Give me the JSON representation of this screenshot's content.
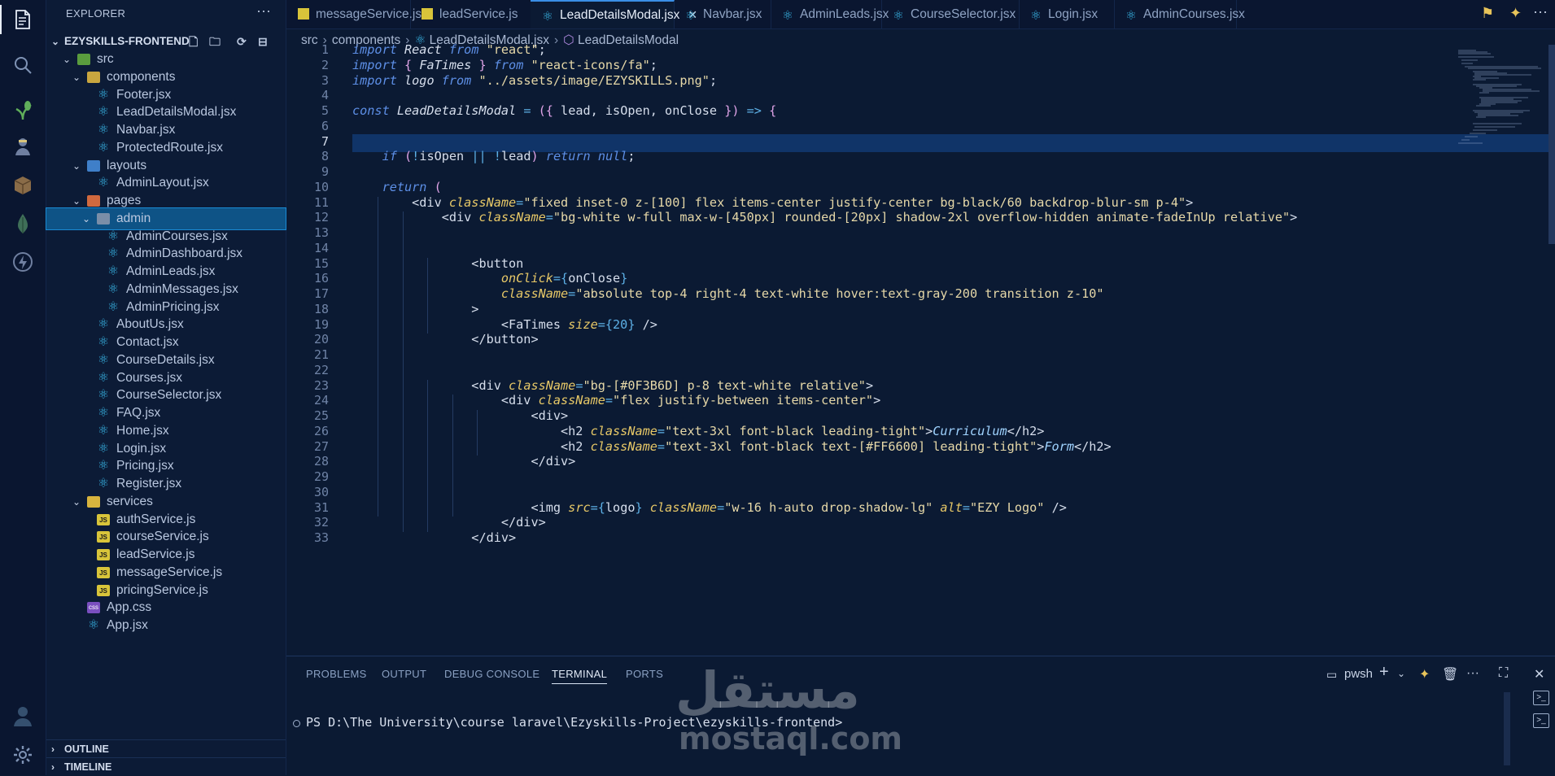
{
  "explorer": {
    "title": "EXPLORER",
    "more": "···",
    "root": "EZYSKILLS-FRONTEND",
    "items": [
      {
        "label": "src",
        "type": "folder-src",
        "depth": 1,
        "chev": "v"
      },
      {
        "label": "components",
        "type": "folder-comp",
        "depth": 2,
        "chev": "v"
      },
      {
        "label": "Footer.jsx",
        "type": "react",
        "depth": 3,
        "chev": ""
      },
      {
        "label": "LeadDetailsModal.jsx",
        "type": "react",
        "depth": 3,
        "chev": ""
      },
      {
        "label": "Navbar.jsx",
        "type": "react",
        "depth": 3,
        "chev": ""
      },
      {
        "label": "ProtectedRoute.jsx",
        "type": "react",
        "depth": 3,
        "chev": ""
      },
      {
        "label": "layouts",
        "type": "folder-layout",
        "depth": 2,
        "chev": "v"
      },
      {
        "label": "AdminLayout.jsx",
        "type": "react",
        "depth": 3,
        "chev": ""
      },
      {
        "label": "pages",
        "type": "folder-pages",
        "depth": 2,
        "chev": "v"
      },
      {
        "label": "admin",
        "type": "folder-admin",
        "depth": 3,
        "chev": "v",
        "selected": true
      },
      {
        "label": "AdminCourses.jsx",
        "type": "react",
        "depth": 4,
        "chev": ""
      },
      {
        "label": "AdminDashboard.jsx",
        "type": "react",
        "depth": 4,
        "chev": ""
      },
      {
        "label": "AdminLeads.jsx",
        "type": "react",
        "depth": 4,
        "chev": ""
      },
      {
        "label": "AdminMessages.jsx",
        "type": "react",
        "depth": 4,
        "chev": ""
      },
      {
        "label": "AdminPricing.jsx",
        "type": "react",
        "depth": 4,
        "chev": ""
      },
      {
        "label": "AboutUs.jsx",
        "type": "react",
        "depth": 3,
        "chev": ""
      },
      {
        "label": "Contact.jsx",
        "type": "react",
        "depth": 3,
        "chev": ""
      },
      {
        "label": "CourseDetails.jsx",
        "type": "react",
        "depth": 3,
        "chev": ""
      },
      {
        "label": "Courses.jsx",
        "type": "react",
        "depth": 3,
        "chev": ""
      },
      {
        "label": "CourseSelector.jsx",
        "type": "react",
        "depth": 3,
        "chev": ""
      },
      {
        "label": "FAQ.jsx",
        "type": "react",
        "depth": 3,
        "chev": ""
      },
      {
        "label": "Home.jsx",
        "type": "react",
        "depth": 3,
        "chev": ""
      },
      {
        "label": "Login.jsx",
        "type": "react",
        "depth": 3,
        "chev": ""
      },
      {
        "label": "Pricing.jsx",
        "type": "react",
        "depth": 3,
        "chev": ""
      },
      {
        "label": "Register.jsx",
        "type": "react",
        "depth": 3,
        "chev": ""
      },
      {
        "label": "services",
        "type": "folder-services",
        "depth": 2,
        "chev": "v"
      },
      {
        "label": "authService.js",
        "type": "js",
        "depth": 3,
        "chev": ""
      },
      {
        "label": "courseService.js",
        "type": "js",
        "depth": 3,
        "chev": ""
      },
      {
        "label": "leadService.js",
        "type": "js",
        "depth": 3,
        "chev": ""
      },
      {
        "label": "messageService.js",
        "type": "js",
        "depth": 3,
        "chev": ""
      },
      {
        "label": "pricingService.js",
        "type": "js",
        "depth": 3,
        "chev": ""
      },
      {
        "label": "App.css",
        "type": "css",
        "depth": 2,
        "chev": ""
      },
      {
        "label": "App.jsx",
        "type": "react",
        "depth": 2,
        "chev": ""
      }
    ],
    "outline": "OUTLINE",
    "timeline": "TIMELINE"
  },
  "tabs": [
    {
      "label": "messageService.js",
      "type": "js"
    },
    {
      "label": "leadService.js",
      "type": "js"
    },
    {
      "label": "LeadDetailsModal.jsx",
      "type": "react",
      "active": true,
      "close": "✕"
    },
    {
      "label": "Navbar.jsx",
      "type": "react"
    },
    {
      "label": "AdminLeads.jsx",
      "type": "react"
    },
    {
      "label": "CourseSelector.jsx",
      "type": "react"
    },
    {
      "label": "Login.jsx",
      "type": "react"
    },
    {
      "label": "AdminCourses.jsx",
      "type": "react"
    }
  ],
  "breadcrumb": {
    "parts": [
      "src",
      "components",
      "LeadDetailsModal.jsx",
      "LeadDetailsModal"
    ]
  },
  "editor": {
    "line_numbers": [
      "1",
      "2",
      "3",
      "4",
      "5",
      "6",
      "7",
      "8",
      "9",
      "10",
      "11",
      "12",
      "13",
      "14",
      "15",
      "16",
      "17",
      "18",
      "19",
      "20",
      "21",
      "22",
      "23",
      "24",
      "25",
      "26",
      "27",
      "28",
      "29",
      "30",
      "31",
      "32",
      "33"
    ],
    "lines": [
      [
        [
          "kw",
          "import"
        ],
        [
          "ital",
          " React "
        ],
        [
          "kw",
          "from"
        ],
        [
          "str",
          " \"react\""
        ],
        [
          "tag",
          ";"
        ]
      ],
      [
        [
          "kw",
          "import"
        ],
        [
          "pn",
          " { "
        ],
        [
          "ital",
          "FaTimes"
        ],
        [
          "pn",
          " } "
        ],
        [
          "kw",
          "from"
        ],
        [
          "str",
          " \"react-icons/fa\""
        ],
        [
          "tag",
          ";"
        ]
      ],
      [
        [
          "kw",
          "import"
        ],
        [
          "ital",
          " logo "
        ],
        [
          "kw",
          "from"
        ],
        [
          "str",
          " \"../assets/image/EZYSKILLS.png\""
        ],
        [
          "tag",
          ";"
        ]
      ],
      [],
      [
        [
          "kw",
          "const"
        ],
        [
          "ital",
          " LeadDetailsModal "
        ],
        [
          "op",
          "="
        ],
        [
          "pn",
          " ({ "
        ],
        [
          "tag",
          "lead, isOpen, onClose "
        ],
        [
          "pn",
          "}) "
        ],
        [
          "op",
          "=>"
        ],
        [
          "pn",
          " {"
        ]
      ],
      [],
      [],
      [
        [
          "tag",
          "    "
        ],
        [
          "kw",
          "if"
        ],
        [
          "pn",
          " ("
        ],
        [
          "op",
          "!"
        ],
        [
          "tag",
          "isOpen "
        ],
        [
          "op",
          "||"
        ],
        [
          "tag",
          " "
        ],
        [
          "op",
          "!"
        ],
        [
          "tag",
          "lead"
        ],
        [
          "pn",
          ")"
        ],
        [
          "kw",
          " return null"
        ],
        [
          "tag",
          ";"
        ]
      ],
      [],
      [
        [
          "tag",
          "    "
        ],
        [
          "kw",
          "return"
        ],
        [
          "pn",
          " ("
        ]
      ],
      [
        [
          "tag",
          "        <div "
        ],
        [
          "attr",
          "className"
        ],
        [
          "op",
          "="
        ],
        [
          "str",
          "\"fixed inset-0 z-[100] flex items-center justify-center bg-black/60 backdrop-blur-sm p-4\""
        ],
        [
          "tag",
          ">"
        ]
      ],
      [
        [
          "tag",
          "            <div "
        ],
        [
          "attr",
          "className"
        ],
        [
          "op",
          "="
        ],
        [
          "str",
          "\"bg-white w-full max-w-[450px] rounded-[20px] shadow-2xl overflow-hidden animate-fadeInUp relative\""
        ],
        [
          "tag",
          ">"
        ]
      ],
      [],
      [],
      [
        [
          "tag",
          "                <button"
        ]
      ],
      [
        [
          "tag",
          "                    "
        ],
        [
          "attr",
          "onClick"
        ],
        [
          "op",
          "={"
        ],
        [
          "tag",
          "onClose"
        ],
        [
          "op",
          "}"
        ]
      ],
      [
        [
          "tag",
          "                    "
        ],
        [
          "attr",
          "className"
        ],
        [
          "op",
          "="
        ],
        [
          "str",
          "\"absolute top-4 right-4 text-white hover:text-gray-200 transition z-10\""
        ]
      ],
      [
        [
          "tag",
          "                >"
        ]
      ],
      [
        [
          "tag",
          "                    <FaTimes "
        ],
        [
          "attr",
          "size"
        ],
        [
          "op",
          "={20}"
        ],
        [
          "tag",
          " />"
        ]
      ],
      [
        [
          "tag",
          "                </button>"
        ]
      ],
      [],
      [],
      [
        [
          "tag",
          "                <div "
        ],
        [
          "attr",
          "className"
        ],
        [
          "op",
          "="
        ],
        [
          "str",
          "\"bg-[#0F3B6D] p-8 text-white relative\""
        ],
        [
          "tag",
          ">"
        ]
      ],
      [
        [
          "tag",
          "                    <div "
        ],
        [
          "attr",
          "className"
        ],
        [
          "op",
          "="
        ],
        [
          "str",
          "\"flex justify-between items-center\""
        ],
        [
          "tag",
          ">"
        ]
      ],
      [
        [
          "tag",
          "                        <div>"
        ]
      ],
      [
        [
          "tag",
          "                            <h2 "
        ],
        [
          "attr",
          "className"
        ],
        [
          "op",
          "="
        ],
        [
          "str",
          "\"text-3xl font-black leading-tight\""
        ],
        [
          "tag",
          ">"
        ],
        [
          "fn",
          "Curriculum"
        ],
        [
          "tag",
          "</h2>"
        ]
      ],
      [
        [
          "tag",
          "                            <h2 "
        ],
        [
          "attr",
          "className"
        ],
        [
          "op",
          "="
        ],
        [
          "str",
          "\"text-3xl font-black text-[#FF6600] leading-tight\""
        ],
        [
          "tag",
          ">"
        ],
        [
          "fn",
          "Form"
        ],
        [
          "tag",
          "</h2>"
        ]
      ],
      [
        [
          "tag",
          "                        </div>"
        ]
      ],
      [],
      [],
      [
        [
          "tag",
          "                        <img "
        ],
        [
          "attr",
          "src"
        ],
        [
          "op",
          "={"
        ],
        [
          "tag",
          "logo"
        ],
        [
          "op",
          "} "
        ],
        [
          "attr",
          "className"
        ],
        [
          "op",
          "="
        ],
        [
          "str",
          "\"w-16 h-auto drop-shadow-lg\""
        ],
        [
          "tag",
          " "
        ],
        [
          "attr",
          "alt"
        ],
        [
          "op",
          "="
        ],
        [
          "str",
          "\"EZY Logo\""
        ],
        [
          "tag",
          " />"
        ]
      ],
      [
        [
          "tag",
          "                    </div>"
        ]
      ],
      [
        [
          "tag",
          "                </div>"
        ]
      ]
    ]
  },
  "panel": {
    "tabs": [
      "PROBLEMS",
      "OUTPUT",
      "DEBUG CONSOLE",
      "TERMINAL",
      "PORTS"
    ],
    "active_tab": "TERMINAL",
    "shell": "pwsh",
    "prompt": "PS D:\\The University\\course laravel\\Ezyskills-Project\\ezyskills-frontend>"
  },
  "watermark": {
    "arabic": "مستقل",
    "latin": "mostaql.com"
  },
  "colors": {
    "background": "#0b1a33",
    "sidebar": "#0c1b36",
    "selection": "#0e5386",
    "current_line": "#103468",
    "accent": "#3a8ee6"
  }
}
